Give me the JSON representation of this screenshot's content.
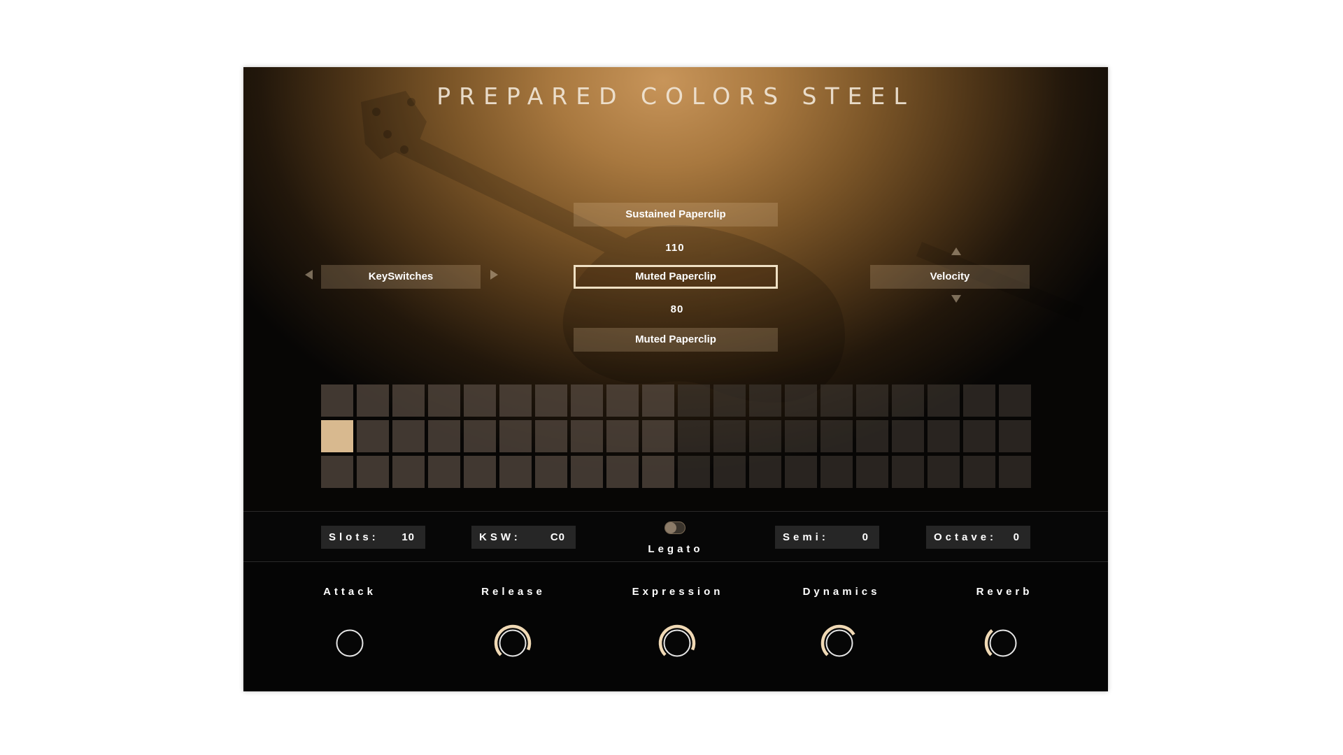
{
  "title": "PREPARED COLORS STEEL",
  "colors": {
    "accent": "#d8b98f",
    "knob_arc": "#f0d9b5",
    "knob_ring": "#e6e6e6",
    "panel_dark": "#070707"
  },
  "articulations": {
    "top": "Sustained Paperclip",
    "upper_value": "110",
    "selected": "Muted Paperclip",
    "lower_value": "80",
    "bottom": "Muted Paperclip"
  },
  "left_selector": {
    "label": "KeySwitches",
    "prev_icon": "triangle-left-icon",
    "next_icon": "triangle-right-icon"
  },
  "right_selector": {
    "label": "Velocity",
    "up_icon": "triangle-up-icon",
    "down_icon": "triangle-down-icon"
  },
  "slot_grid": {
    "columns": 20,
    "rows": 3,
    "active_columns": 10,
    "selected_row": 2,
    "selected_column": 1
  },
  "controls": {
    "slots": {
      "label": "Slots:",
      "value": "10"
    },
    "ksw": {
      "label": "KSW:",
      "value": "C0"
    },
    "legato": {
      "label": "Legato",
      "on": false
    },
    "semi": {
      "label": "Semi:",
      "value": "0"
    },
    "octave": {
      "label": "Octave:",
      "value": "0"
    }
  },
  "knobs": [
    {
      "label": "Attack",
      "value": 0.0
    },
    {
      "label": "Release",
      "value": 0.92
    },
    {
      "label": "Expression",
      "value": 0.92
    },
    {
      "label": "Dynamics",
      "value": 0.72
    },
    {
      "label": "Reverb",
      "value": 0.35
    }
  ]
}
